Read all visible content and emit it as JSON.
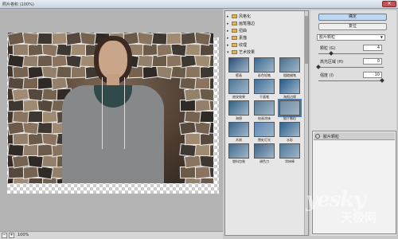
{
  "window": {
    "title": "照片卷积 (100%)",
    "close_label": "✕"
  },
  "status": {
    "minus": "−",
    "plus": "+",
    "zoom": "100%"
  },
  "effects": {
    "categories": [
      {
        "label": "风格化",
        "expanded": false
      },
      {
        "label": "画笔描边",
        "expanded": false
      },
      {
        "label": "扭曲",
        "expanded": false
      },
      {
        "label": "素描",
        "expanded": false
      },
      {
        "label": "纹理",
        "expanded": false
      },
      {
        "label": "艺术效果",
        "expanded": true
      }
    ],
    "thumbs": [
      {
        "label": "壁画",
        "color": "#2b4f7a",
        "selected": false
      },
      {
        "label": "彩色铅笔",
        "color": "#3a6a92",
        "selected": false
      },
      {
        "label": "粗糙蜡笔",
        "color": "#4a6f8f",
        "selected": false
      },
      {
        "label": "底纹效果",
        "color": "#4e7696",
        "selected": false
      },
      {
        "label": "干画笔",
        "color": "#3d6d99",
        "selected": false
      },
      {
        "label": "海报边缘",
        "color": "#245b8a",
        "selected": false
      },
      {
        "label": "海绵",
        "color": "#2f6186",
        "selected": false
      },
      {
        "label": "绘画涂抹",
        "color": "#5a7c98",
        "selected": false
      },
      {
        "label": "胶片颗粒",
        "color": "#6f8aa0",
        "selected": true
      },
      {
        "label": "木刻",
        "color": "#3b668c",
        "selected": false
      },
      {
        "label": "霓虹灯光",
        "color": "#5b86b4",
        "selected": false
      },
      {
        "label": "水彩",
        "color": "#2e5f8d",
        "selected": false
      },
      {
        "label": "塑料包装",
        "color": "#446c90",
        "selected": false
      },
      {
        "label": "调色刀",
        "color": "#3f6588",
        "selected": false
      },
      {
        "label": "涂抹棒",
        "color": "#4d7899",
        "selected": false
      }
    ]
  },
  "settings": {
    "ok_label": "确定",
    "reset_label": "复位",
    "filter_name": "胶片颗粒",
    "params": [
      {
        "label": "颗粒 (G)",
        "value": "4",
        "max": 20
      },
      {
        "label": "高光区域 (H)",
        "value": "0",
        "max": 20
      },
      {
        "label": "强度 (I)",
        "value": "10",
        "max": 10
      }
    ]
  },
  "layers": {
    "row_label": "胶片颗粒"
  },
  "watermark": {
    "main": "yesky",
    "sub": "天极网"
  }
}
